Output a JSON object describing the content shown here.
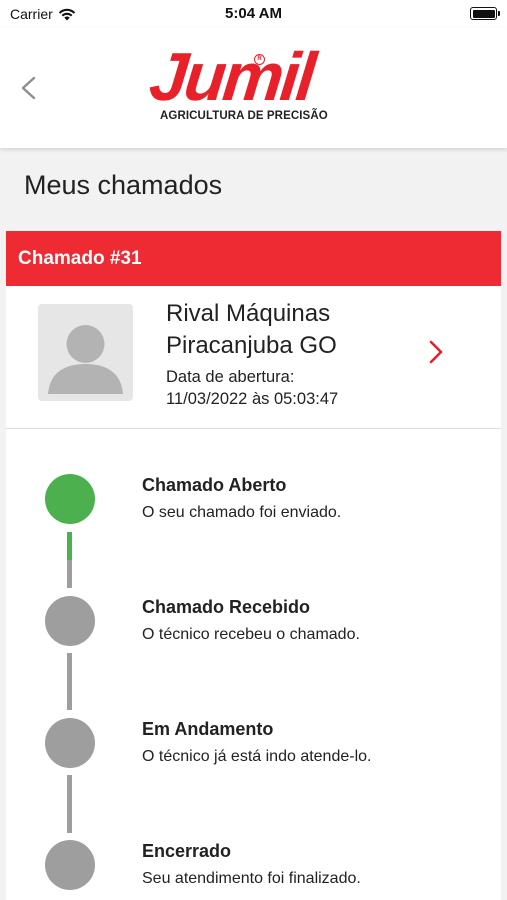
{
  "status_bar": {
    "carrier": "Carrier",
    "time": "5:04 AM",
    "wifi_icon": "wifi-icon",
    "battery_icon": "battery-icon"
  },
  "header": {
    "back_icon": "chevron-left-icon",
    "logo": {
      "word": "Jumil",
      "tagline": "AGRICULTURA DE PRECISÃO"
    }
  },
  "page": {
    "title": "Meus chamados"
  },
  "ticket": {
    "header_label": "Chamado #31",
    "client_line1": "Rival Máquinas",
    "client_line2": "Piracanjuba GO",
    "date_label": "Data de abertura:",
    "date_value": "11/03/2022 às 05:03:47",
    "avatar_icon": "user-placeholder-icon",
    "open_icon": "chevron-right-icon"
  },
  "timeline": {
    "steps": [
      {
        "title": "Chamado Aberto",
        "description": "O seu chamado foi enviado.",
        "status": "done"
      },
      {
        "title": "Chamado Recebido",
        "description": "O técnico recebeu o chamado.",
        "status": "pending"
      },
      {
        "title": "Em Andamento",
        "description": "O técnico já está indo atende-lo.",
        "status": "pending"
      },
      {
        "title": "Encerrado",
        "description": "Seu atendimento foi finalizado.",
        "status": "pending"
      }
    ]
  },
  "colors": {
    "brand_red": "#ee2b33",
    "done_green": "#4cb04f",
    "pending_gray": "#9e9e9e"
  }
}
